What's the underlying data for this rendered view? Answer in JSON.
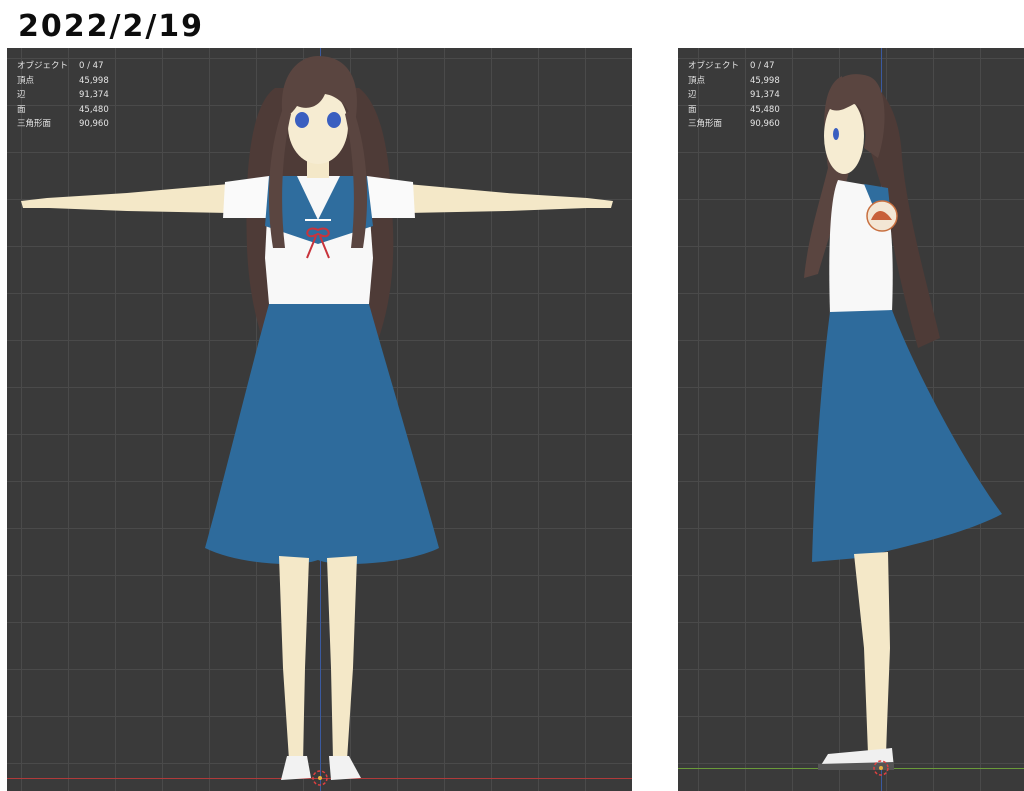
{
  "header": {
    "title": "2022/2/19"
  },
  "viewports": {
    "front": {
      "stats": [
        {
          "label": "オブジェクト",
          "value": "0 / 47"
        },
        {
          "label": "頂点",
          "value": "45,998"
        },
        {
          "label": "辺",
          "value": "91,374"
        },
        {
          "label": "面",
          "value": "45,480"
        },
        {
          "label": "三角形面",
          "value": "90,960"
        }
      ]
    },
    "side": {
      "stats": [
        {
          "label": "オブジェクト",
          "value": "0 / 47"
        },
        {
          "label": "頂点",
          "value": "45,998"
        },
        {
          "label": "辺",
          "value": "91,374"
        },
        {
          "label": "面",
          "value": "45,480"
        },
        {
          "label": "三角形面",
          "value": "90,960"
        }
      ]
    }
  },
  "colors": {
    "viewport_bg": "#3a3a3a",
    "grid": "#4a4a4a",
    "x_axis": "#b03a3a",
    "y_axis": "#6a9a3a",
    "z_axis": "#3a5aa0",
    "skirt": "#2e6b9c",
    "hair": "#5a4540",
    "skin": "#f6ecd0"
  }
}
